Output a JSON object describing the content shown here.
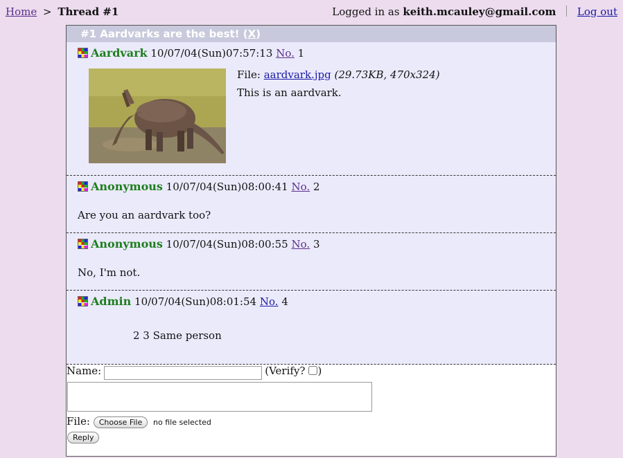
{
  "breadcrumb": {
    "home": "Home",
    "sep": ">",
    "current": "Thread #1"
  },
  "login": {
    "prefix": "Logged in as",
    "user": "keith.mcauley@gmail.com",
    "logout": "Log out"
  },
  "thread": {
    "title": "#1 Aardvarks are the best! (",
    "close": "X",
    "title_end": ")"
  },
  "posts": [
    {
      "name": "Aardvark",
      "date": "10/07/04(Sun)07:57:13",
      "no_label": "No.",
      "no": "1",
      "file_label": "File:",
      "file_name": "aardvark.jpg",
      "file_size": "(29.73KB, 470x324)",
      "body": "This is an aardvark."
    },
    {
      "name": "Anonymous",
      "date": "10/07/04(Sun)08:00:41",
      "no_label": "No.",
      "no": "2",
      "body": "Are you an aardvark too?"
    },
    {
      "name": "Anonymous",
      "date": "10/07/04(Sun)08:00:55",
      "no_label": "No.",
      "no": "3",
      "body": "No, I'm not."
    },
    {
      "name": "Admin",
      "date": "10/07/04(Sun)08:01:54",
      "no_label": "No.",
      "no": "4",
      "body": "2 3 Same person"
    }
  ],
  "form": {
    "name_label": "Name:",
    "name_value": "",
    "verify_open": "(Verify?",
    "verify_close": ")",
    "file_label": "File:",
    "choose_file": "Choose File",
    "no_file": "no file selected",
    "reply": "Reply"
  },
  "colors": {
    "background": "#ecdcee",
    "post_bg": "#ebeafb",
    "header_bg": "#c8c9dc",
    "name": "#1e7e1e"
  }
}
